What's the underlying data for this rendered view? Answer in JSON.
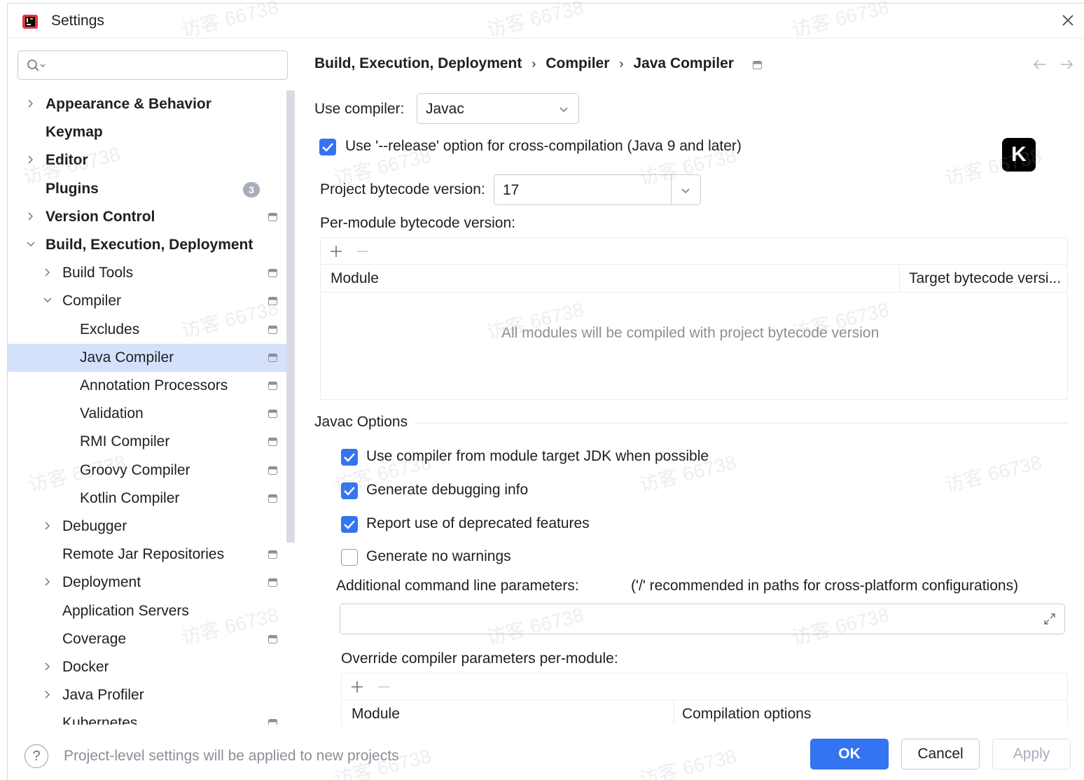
{
  "window": {
    "title": "Settings"
  },
  "search": {
    "placeholder": ""
  },
  "sidebar": {
    "items": [
      {
        "label": "Appearance & Behavior",
        "bold": true,
        "chevron": "right"
      },
      {
        "label": "Keymap",
        "bold": true
      },
      {
        "label": "Editor",
        "bold": true,
        "chevron": "right"
      },
      {
        "label": "Plugins",
        "bold": true,
        "badge": "3"
      },
      {
        "label": "Version Control",
        "bold": true,
        "chevron": "right",
        "project_icon": true
      },
      {
        "label": "Build, Execution, Deployment",
        "bold": true,
        "chevron": "down"
      },
      {
        "label": "Build Tools",
        "chevron": "right",
        "project_icon": true
      },
      {
        "label": "Compiler",
        "chevron": "down",
        "project_icon": true
      },
      {
        "label": "Excludes",
        "project_icon": true
      },
      {
        "label": "Java Compiler",
        "project_icon": true,
        "selected": true
      },
      {
        "label": "Annotation Processors",
        "project_icon": true
      },
      {
        "label": "Validation",
        "project_icon": true
      },
      {
        "label": "RMI Compiler",
        "project_icon": true
      },
      {
        "label": "Groovy Compiler",
        "project_icon": true
      },
      {
        "label": "Kotlin Compiler",
        "project_icon": true
      },
      {
        "label": "Debugger",
        "chevron": "right"
      },
      {
        "label": "Remote Jar Repositories",
        "project_icon": true
      },
      {
        "label": "Deployment",
        "chevron": "right",
        "project_icon": true
      },
      {
        "label": "Application Servers"
      },
      {
        "label": "Coverage",
        "project_icon": true
      },
      {
        "label": "Docker",
        "chevron": "right"
      },
      {
        "label": "Java Profiler",
        "chevron": "right"
      },
      {
        "label": "Kubernetes",
        "project_icon": true
      }
    ]
  },
  "breadcrumb": {
    "items": [
      "Build, Execution, Deployment",
      "Compiler",
      "Java Compiler"
    ],
    "separator": "›"
  },
  "compiler": {
    "use_compiler_label": "Use compiler:",
    "use_compiler_value": "Javac",
    "release_option_label": "Use '--release' option for cross-compilation (Java 9 and later)",
    "release_option_checked": true,
    "bytecode_label": "Project bytecode version:",
    "bytecode_value": "17",
    "per_module_label": "Per-module bytecode version:",
    "per_module_table": {
      "columns": [
        "Module",
        "Target bytecode versi..."
      ],
      "empty_text": "All modules will be compiled with project bytecode version"
    }
  },
  "javac": {
    "section_title": "Javac Options",
    "options": [
      {
        "label": "Use compiler from module target JDK when possible",
        "checked": true
      },
      {
        "label": "Generate debugging info",
        "checked": true
      },
      {
        "label": "Report use of deprecated features",
        "checked": true
      },
      {
        "label": "Generate no warnings",
        "checked": false
      }
    ],
    "additional_label": "Additional command line parameters:",
    "additional_hint": "('/' recommended in paths for cross-platform configurations)",
    "additional_value": "",
    "override_label": "Override compiler parameters per-module:",
    "override_table": {
      "columns": [
        "Module",
        "Compilation options"
      ]
    }
  },
  "footer": {
    "help_icon": "?",
    "hint": "Project-level settings will be applied to new projects",
    "ok": "OK",
    "cancel": "Cancel",
    "apply": "Apply"
  },
  "overlay_logo": "K",
  "watermark_text": "访客 66738",
  "colors": {
    "accent": "#3574f0",
    "selection": "#d5e1fb",
    "muted_text": "#8c8f99"
  }
}
